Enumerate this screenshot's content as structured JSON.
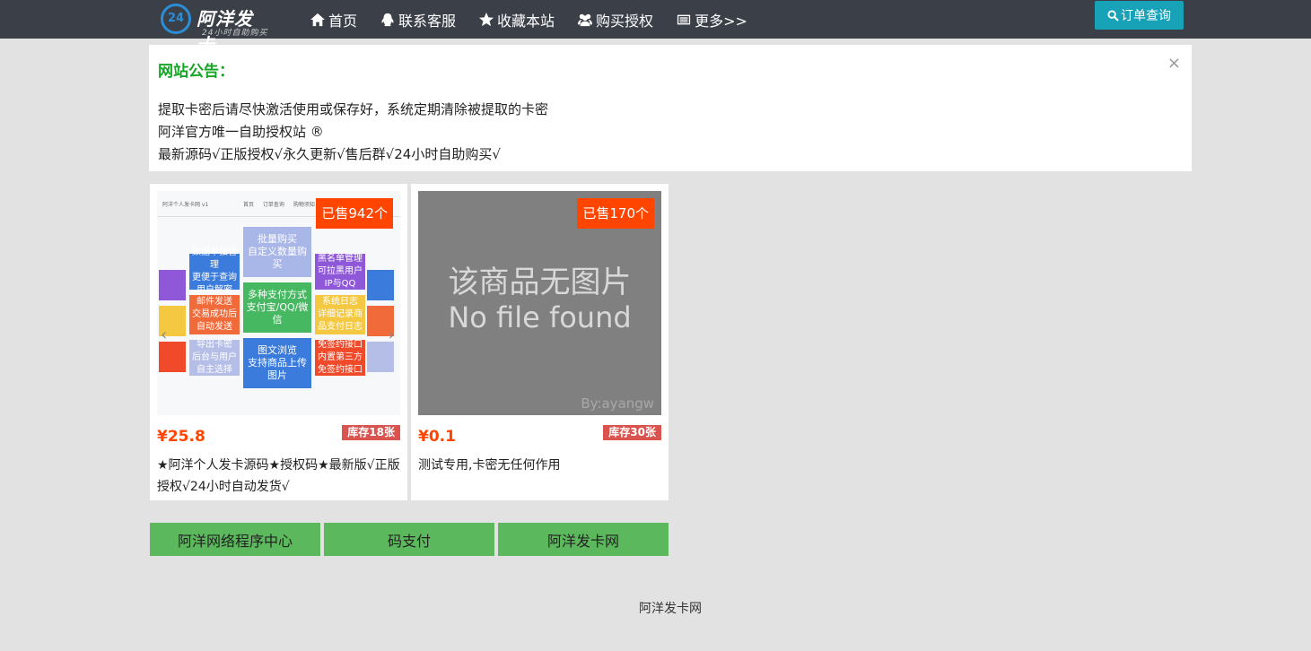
{
  "header": {
    "logo_badge": "24",
    "logo_title": "阿洋发卡",
    "logo_subtitle": "24小时自助购买",
    "nav": [
      {
        "label": "首页",
        "icon": "home-icon"
      },
      {
        "label": "联系客服",
        "icon": "qq-penguin-icon"
      },
      {
        "label": "收藏本站",
        "icon": "star-icon"
      },
      {
        "label": "购买授权",
        "icon": "users-icon"
      },
      {
        "label": "更多>>",
        "icon": "list-icon"
      }
    ],
    "order_button": "订单查询"
  },
  "notice": {
    "title": "网站公告：",
    "close": "×",
    "lines": [
      "提取卡密后请尽快激活使用或保存好，系统定期清除被提取的卡密",
      "阿洋官方唯一自助授权站 ®",
      "最新源码√正版授权√永久更新√售后群√24小时自助购买√"
    ]
  },
  "products": [
    {
      "sold": "已售942个",
      "price": "¥25.8",
      "stock": "库存18张",
      "name": "★阿洋个人发卡源码★授权码★最新版√正版授权√24小时自动发货√",
      "preview": {
        "site_name": "阿洋个人发卡网 v1",
        "menu": "首页 订单查询 购物须知 联系客服",
        "panels": [
          {
            "text": "批量购买\n自定义数量购买",
            "color": "#a9b6e8"
          },
          {
            "text": "多种支付方式\n支付宝/QQ/微信",
            "color": "#47b862"
          },
          {
            "text": "图文浏览\n支持商品上传图片",
            "color": "#3a7bdc"
          },
          {
            "text": "数据单独管理\n更便于查询 用户解密",
            "color": "#3a7bdc"
          },
          {
            "text": "邮件发送\n交易成功后自动发送",
            "color": "#f06a3a"
          },
          {
            "text": "导出卡密\n后台与用户自主选择",
            "color": "#b5bee6"
          },
          {
            "text": "黑名单管理\n可拉黑用户IP与QQ",
            "color": "#8e58d8"
          },
          {
            "text": "系统日志\n详细记录商品支付日志",
            "color": "#f5c842"
          },
          {
            "text": "免签约接口\n内置第三方免签约接口",
            "color": "#f04a2a"
          }
        ]
      }
    },
    {
      "sold": "已售170个",
      "price": "¥0.1",
      "stock": "库存30张",
      "name": "测试专用,卡密无任何作用",
      "no_image_line1": "该商品无图片",
      "no_image_line2": "No file found",
      "no_image_by": "By:ayangw"
    }
  ],
  "links": [
    "阿洋网络程序中心",
    "码支付",
    "阿洋发卡网"
  ],
  "footer": "阿洋发卡网"
}
